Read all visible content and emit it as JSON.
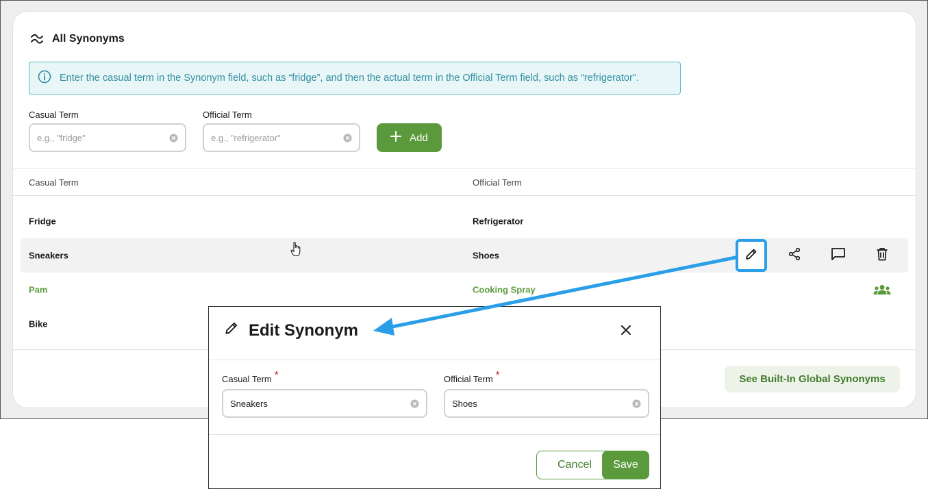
{
  "section": {
    "title": "All Synonyms",
    "icon": "approx-equal-icon"
  },
  "info_banner": {
    "text": "Enter the casual term in the Synonym field, such as “fridge”, and then the actual term in the Official Term field, such as “refrigerator”."
  },
  "form": {
    "casual_label": "Casual Term",
    "casual_placeholder": "e.g., \"fridge\"",
    "official_label": "Official Term",
    "official_placeholder": "e.g., \"refrigerator\"",
    "add_label": "Add"
  },
  "table": {
    "headers": [
      "Casual Term",
      "Official Term"
    ],
    "rows": [
      {
        "casual": "Fridge",
        "official": "Refrigerator"
      },
      {
        "casual": "Sneakers",
        "official": "Shoes"
      },
      {
        "casual": "Pam",
        "official": "Cooking Spray"
      },
      {
        "casual": "Bike",
        "official": ""
      }
    ]
  },
  "global_button": "See Built-In Global Synonyms",
  "modal": {
    "title": "Edit Synonym",
    "casual_label": "Casual Term",
    "casual_value": "Sneakers",
    "official_label": "Official Term",
    "official_value": "Shoes",
    "required_mark": "*",
    "cancel": "Cancel",
    "save": "Save"
  },
  "colors": {
    "accent_green": "#5b9a3c",
    "info_blue": "#2f8fa0",
    "callout_blue": "#2a9fe8"
  }
}
